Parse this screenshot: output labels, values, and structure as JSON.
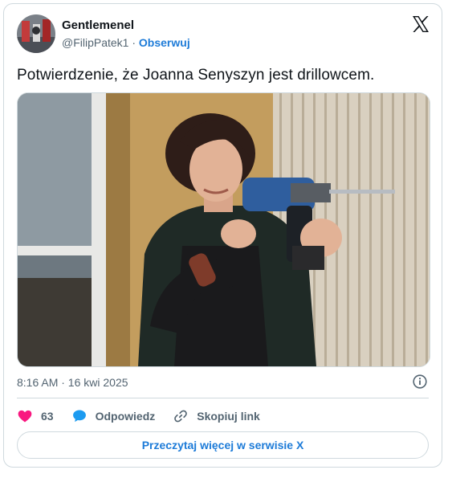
{
  "tweet": {
    "author_name": "Gentlemenel",
    "author_handle": "@FilipPatek1",
    "separator": "·",
    "follow_label": "Obserwuj",
    "text": "Potwierdzenie, że Joanna Senyszyn jest drillowcem.",
    "timestamp": "8:16 AM · 16 kwi 2025",
    "like_count": "63",
    "reply_label": "Odpowiedz",
    "copy_link_label": "Skopiuj link",
    "read_more_label": "Przeczytaj więcej w serwisie X"
  },
  "icons": {
    "brand": "x-logo-icon",
    "info": "info-icon",
    "like": "heart-icon",
    "reply": "speech-bubble-icon",
    "copy": "link-icon"
  },
  "colors": {
    "accent": "#1d7bd8",
    "like": "#f91880",
    "text_secondary": "#536471",
    "border": "#cfd9de"
  }
}
